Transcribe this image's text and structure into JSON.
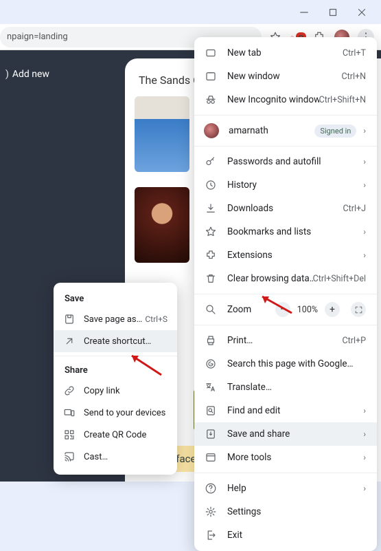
{
  "window": {
    "url_fragment": "npaign=landing"
  },
  "addrbar": {
    "notif_count": "2"
  },
  "page": {
    "add_new": "Add new",
    "heading": "The Sands C",
    "button_partial": "ap faces"
  },
  "menu": {
    "new_tab": {
      "label": "New tab",
      "shortcut": "Ctrl+T"
    },
    "new_window": {
      "label": "New window",
      "shortcut": "Ctrl+N"
    },
    "new_incognito": {
      "label": "New Incognito window",
      "shortcut": "Ctrl+Shift+N"
    },
    "profile": {
      "label": "amarnath",
      "pill": "Signed in"
    },
    "passwords": {
      "label": "Passwords and autofill"
    },
    "history": {
      "label": "History"
    },
    "downloads": {
      "label": "Downloads",
      "shortcut": "Ctrl+J"
    },
    "bookmarks": {
      "label": "Bookmarks and lists"
    },
    "extensions": {
      "label": "Extensions"
    },
    "clear": {
      "label": "Clear browsing data…",
      "shortcut": "Ctrl+Shift+Del"
    },
    "zoom": {
      "label": "Zoom",
      "pct": "100%"
    },
    "print": {
      "label": "Print…",
      "shortcut": "Ctrl+P"
    },
    "search_page": {
      "label": "Search this page with Google…"
    },
    "translate": {
      "label": "Translate…"
    },
    "find": {
      "label": "Find and edit"
    },
    "save_share": {
      "label": "Save and share"
    },
    "more_tools": {
      "label": "More tools"
    },
    "help": {
      "label": "Help"
    },
    "settings": {
      "label": "Settings"
    },
    "exit": {
      "label": "Exit"
    }
  },
  "submenu": {
    "head_save": "Save",
    "save_page": {
      "label": "Save page as…",
      "shortcut": "Ctrl+S"
    },
    "shortcut": {
      "label": "Create shortcut…"
    },
    "head_share": "Share",
    "copy_link": {
      "label": "Copy link"
    },
    "send": {
      "label": "Send to your devices"
    },
    "qr": {
      "label": "Create QR Code"
    },
    "cast": {
      "label": "Cast…"
    }
  }
}
